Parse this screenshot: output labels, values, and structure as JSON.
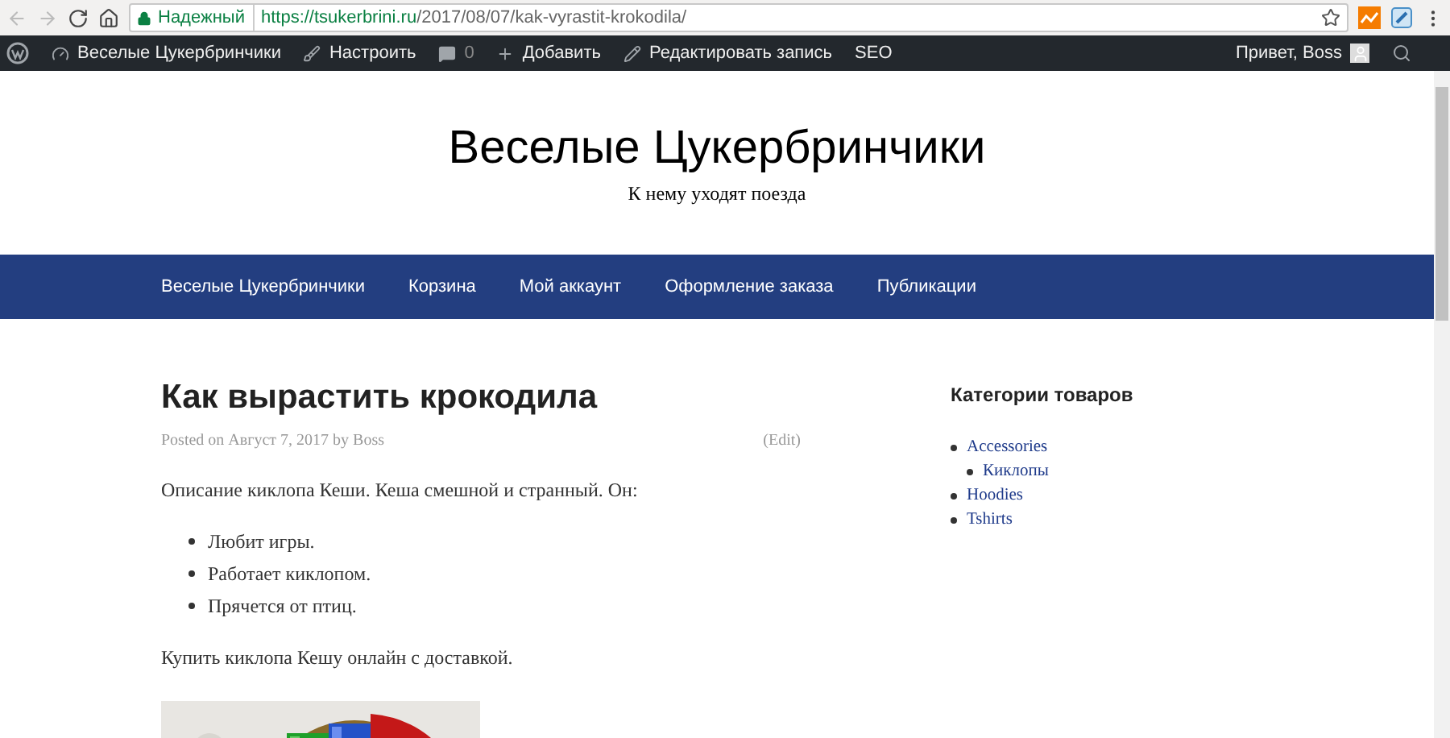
{
  "browser": {
    "security": "Надежный",
    "url_host": "https://tsukerbrini.ru",
    "url_path": "/2017/08/07/kak-vyrastit-krokodila/"
  },
  "admin_bar": {
    "items": [
      {
        "kind": "site",
        "label": "Веселые Цукербринчики"
      },
      {
        "kind": "customize",
        "label": "Настроить"
      },
      {
        "kind": "comments",
        "label": "0"
      },
      {
        "kind": "add",
        "label": "Добавить"
      },
      {
        "kind": "edit",
        "label": "Редактировать запись"
      },
      {
        "kind": "plain",
        "label": "SEO"
      }
    ],
    "greeting": "Привет, Boss"
  },
  "header": {
    "title": "Веселые Цукербринчики",
    "tagline": "К нему уходят поезда"
  },
  "nav": {
    "items": [
      "Веселые Цукербринчики",
      "Корзина",
      "Мой аккаунт",
      "Оформление заказа",
      "Публикации"
    ]
  },
  "post": {
    "title": "Как вырастить крокодила",
    "posted_on": "Posted on",
    "date": "Август 7, 2017",
    "by": "by",
    "author": "Boss",
    "edit": "(Edit)",
    "intro": "Описание киклопа Кеши. Кеша смешной и странный. Он:",
    "bullets": [
      "Любит игры.",
      "Работает киклопом.",
      "Прячется от птиц."
    ],
    "buy": "Купить киклопа Кешу онлайн с доставкой."
  },
  "sidebar": {
    "title": "Категории товаров",
    "categories": [
      {
        "label": "Accessories",
        "children": [
          {
            "label": "Киклопы"
          }
        ]
      },
      {
        "label": "Hoodies"
      },
      {
        "label": "Tshirts"
      }
    ]
  }
}
